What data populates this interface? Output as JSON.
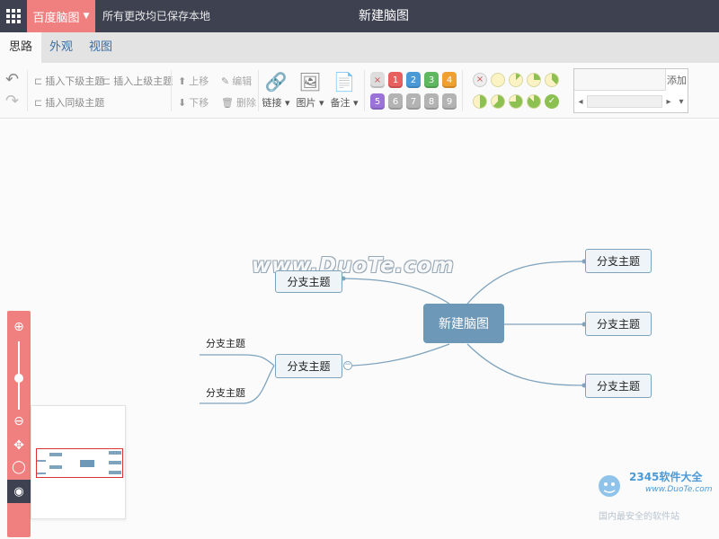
{
  "app": {
    "brand": "百度脑图",
    "save_status": "所有更改均已保存本地",
    "doc_title": "新建脑图"
  },
  "tabs": [
    {
      "label": "思路",
      "active": true
    },
    {
      "label": "外观",
      "active": false
    },
    {
      "label": "视图",
      "active": false
    }
  ],
  "toolbar": {
    "insert_child": "插入下级主题",
    "insert_parent": "插入上级主题",
    "insert_sibling": "插入同级主题",
    "move_up": "上移",
    "move_down": "下移",
    "edit": "编辑",
    "delete": "删除",
    "link": "链接",
    "image": "图片",
    "note": "备注",
    "priority": {
      "clear": "×",
      "items": [
        "1",
        "2",
        "3",
        "4",
        "5",
        "6",
        "7",
        "8",
        "9"
      ],
      "colors": [
        "#e85f5f",
        "#4a9ad8",
        "#5fb85f",
        "#f0a030",
        "#9b72d8",
        "#b3b3b3",
        "#b3b3b3",
        "#b3b3b3",
        "#b3b3b3"
      ]
    },
    "progress": {
      "clear": "×",
      "levels": [
        0,
        0.125,
        0.25,
        0.375,
        0.5,
        0.625,
        0.75,
        0.875,
        1
      ]
    },
    "resource_add": "添加"
  },
  "mindmap": {
    "root": "新建脑图",
    "right_branches": [
      "分支主题",
      "分支主题",
      "分支主题"
    ],
    "left_branches": [
      "分支主题",
      "分支主题"
    ],
    "left_leaves": [
      "分支主题",
      "分支主题"
    ],
    "collapse_symbol": "−"
  },
  "watermark": "www.DuoTe.com",
  "site_logo": {
    "number": "2345软件大全",
    "url": "www.DuoTe.com",
    "slogan": "国内最安全的软件站"
  },
  "colors": {
    "topbar": "#3d4150",
    "accent": "#f08080",
    "node_border": "#7fa3bd",
    "root_fill": "#6e98b8"
  }
}
